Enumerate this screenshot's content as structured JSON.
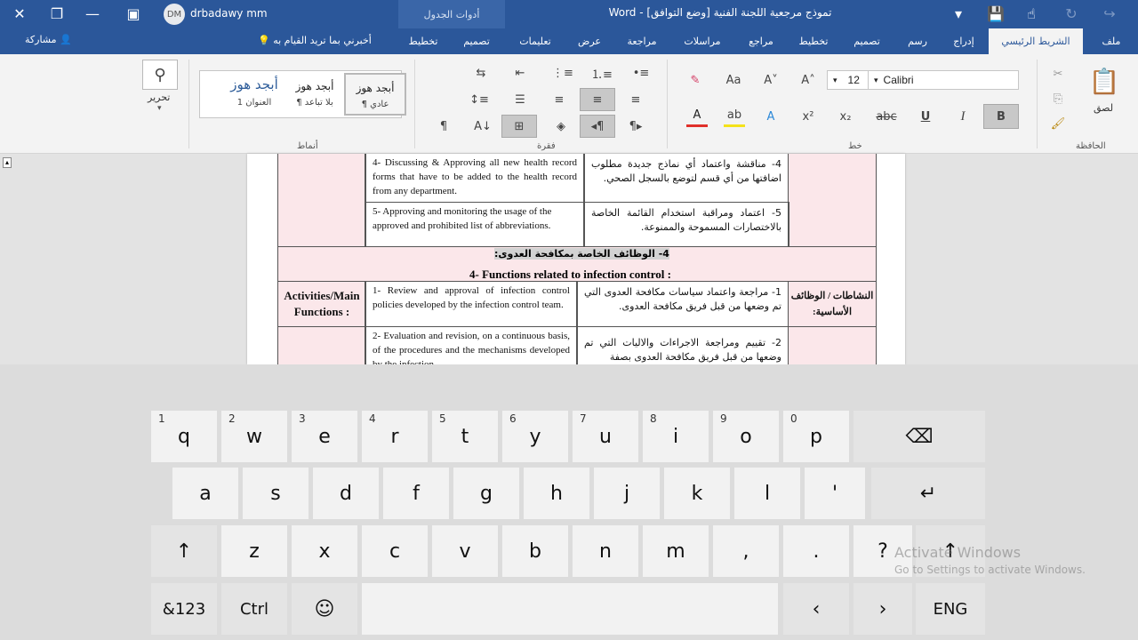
{
  "titlebar": {
    "doc_title": "تموذج مرجعية اللجنة الفنية [وضع التوافق] - Word",
    "context_tab": "أدوات الجدول",
    "user_initials": "DM",
    "user_name": "drbadawy mm"
  },
  "tabs": [
    "ملف",
    "الشريط الرئيسي",
    "إدراج",
    "رسم",
    "تصميم",
    "تخطيط",
    "مراجع",
    "مراسلات",
    "مراجعة",
    "عرض",
    "تعليمات",
    "تصميم",
    "تخطيط"
  ],
  "tell_me": "أخبرني بما تريد القيام به",
  "share": "مشاركة",
  "ribbon": {
    "font_name": "Calibri",
    "font_size": "12",
    "paste_label": "لصق",
    "clipboard_group": "الحافظة",
    "font_group": "خط",
    "paragraph_group": "فقرة",
    "styles_group": "أنماط",
    "editing_label": "تحرير",
    "styles": [
      {
        "sample": "أبجد هوز",
        "name": "¶ عادي"
      },
      {
        "sample": "أبجد هوز",
        "name": "¶ بلا تباعد"
      },
      {
        "sample": "أبجد هوز",
        "name": "العنوان 1"
      }
    ]
  },
  "doc": {
    "row4_en": "4- Discussing & Approving all new health record forms that have to be added to the health record from any department.",
    "row4_ar": "4- مناقشة واعتماد أي نماذج جديدة مطلوب اضافتها من أي قسم لتوضع بالسجل الصحي.",
    "row5_en": "5- Approving and monitoring the usage of the approved and prohibited list of abbreviations.",
    "row5_ar": "5- اعتماد ومراقبة استخدام القائمة الخاصة بالاختصارات المسموحة والممنوعة.",
    "heading_ar": "4- الوظائف الخاصة بمكافحة العدوى:",
    "heading_en": "4- Functions related to infection control :",
    "activities_en": "Activities/Main Functions :",
    "activities_ar": "النشاطات / الوظائف الأساسية:",
    "item1_en": "1- Review and approval of infection control policies developed by the infection control team.",
    "item1_ar": "1- مراجعة واعتماد سياسات مكافحة العدوى التي تم وضعها من قبل فريق مكافحة العدوى.",
    "item2_en": "2- Evaluation and revision, on a continuous basis, of the procedures and the mechanisms developed by the infection",
    "item2_ar": "2- تقييم ومراجعة الاجراءات والاليات التي تم وضعها من قبل فريق مكافحة العدوى بصفة"
  },
  "keyboard": {
    "row1": [
      {
        "k": "q",
        "h": "1"
      },
      {
        "k": "w",
        "h": "2"
      },
      {
        "k": "e",
        "h": "3"
      },
      {
        "k": "r",
        "h": "4"
      },
      {
        "k": "t",
        "h": "5"
      },
      {
        "k": "y",
        "h": "6"
      },
      {
        "k": "u",
        "h": "7"
      },
      {
        "k": "i",
        "h": "8"
      },
      {
        "k": "o",
        "h": "9"
      },
      {
        "k": "p",
        "h": "0"
      }
    ],
    "row2": [
      "a",
      "s",
      "d",
      "f",
      "g",
      "h",
      "j",
      "k",
      "l",
      "'"
    ],
    "row3": [
      "z",
      "x",
      "c",
      "v",
      "b",
      "n",
      "m",
      ",",
      ".",
      "?"
    ],
    "backspace": "⌫",
    "enter": "↵",
    "shift": "↑",
    "symbols": "&123",
    "ctrl": "Ctrl",
    "emoji": "☺",
    "left": "‹",
    "right": "›",
    "lang": "ENG"
  },
  "watermark": {
    "line1": "Activate Windows",
    "line2": "Go to Settings to activate Windows."
  }
}
